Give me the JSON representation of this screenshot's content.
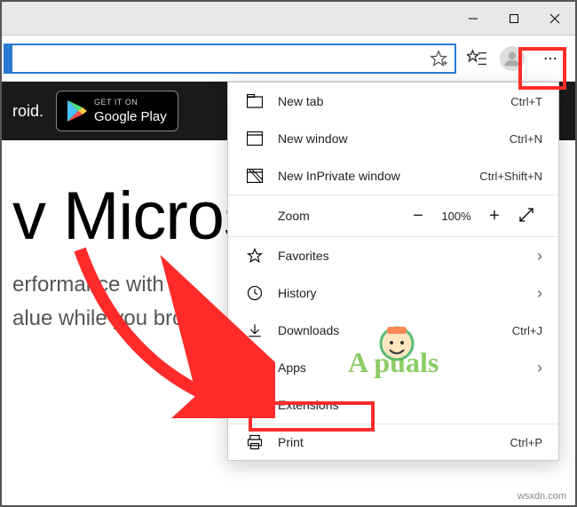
{
  "titlebar": {
    "minimize": "—",
    "maximize": "☐",
    "close": "✕"
  },
  "toolbar": {},
  "banner": {
    "lead_text": "roid.",
    "gplay_small": "GET IT ON",
    "gplay_big": "Google Play"
  },
  "hero": {
    "title_visible": "Micros",
    "title_prefix": "v ",
    "sub1_visible": "erformance with n",
    "sub2_visible": "alue while you bro"
  },
  "menu": {
    "items": [
      {
        "icon": "newtab",
        "label": "New tab",
        "shortcut": "Ctrl+T"
      },
      {
        "icon": "newwin",
        "label": "New window",
        "shortcut": "Ctrl+N"
      },
      {
        "icon": "inpriv",
        "label": "New InPrivate window",
        "shortcut": "Ctrl+Shift+N"
      }
    ],
    "zoom": {
      "label": "Zoom",
      "minus": "−",
      "pct": "100%",
      "plus": "+"
    },
    "items2": [
      {
        "icon": "fav",
        "label": "Favorites",
        "arrow": true
      },
      {
        "icon": "hist",
        "label": "History",
        "arrow": true
      },
      {
        "icon": "dl",
        "label": "Downloads",
        "shortcut": "Ctrl+J"
      },
      {
        "icon": "apps",
        "label": "Apps",
        "arrow": true
      },
      {
        "icon": "ext",
        "label": "Extensions"
      },
      {
        "icon": "print",
        "label": "Print",
        "shortcut": "Ctrl+P"
      }
    ]
  },
  "overlay": {
    "appuals": "A   puals"
  },
  "watermark": "wsxdn.com"
}
